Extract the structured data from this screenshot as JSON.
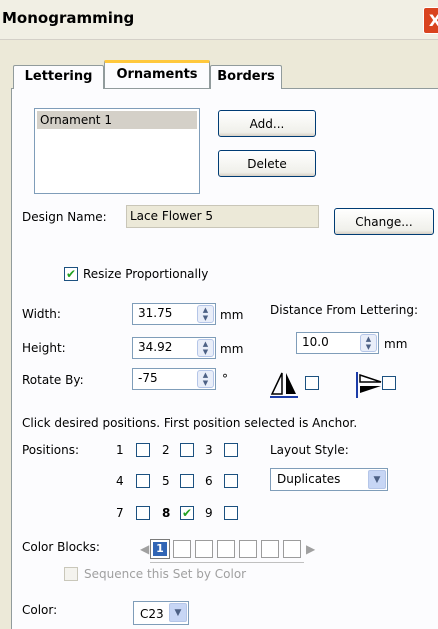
{
  "window": {
    "title": "Monogramming",
    "close_label": "X"
  },
  "tabs": [
    {
      "label": "Lettering",
      "active": false
    },
    {
      "label": "Ornaments",
      "active": true
    },
    {
      "label": "Borders",
      "active": false
    }
  ],
  "ornaments": {
    "items": [
      "Ornament 1"
    ],
    "add_label": "Add...",
    "delete_label": "Delete"
  },
  "design": {
    "label": "Design Name:",
    "value": "Lace Flower 5",
    "change_label": "Change..."
  },
  "resize": {
    "label": "Resize Proportionally",
    "checked": true
  },
  "size": {
    "width_label": "Width:",
    "width_value": "31.75",
    "height_label": "Height:",
    "height_value": "34.92",
    "rotate_label": "Rotate By:",
    "rotate_value": "-75",
    "unit": "mm",
    "degree_symbol": "°"
  },
  "distance": {
    "label": "Distance From Lettering:",
    "value": "10.0",
    "unit": "mm"
  },
  "mirror": {
    "vertical_checked": false,
    "horizontal_checked": false
  },
  "positions": {
    "instructions": "Click desired positions. First position selected is Anchor.",
    "label": "Positions:",
    "items": [
      {
        "num": "1",
        "checked": false
      },
      {
        "num": "2",
        "checked": false
      },
      {
        "num": "3",
        "checked": false
      },
      {
        "num": "4",
        "checked": false
      },
      {
        "num": "5",
        "checked": false
      },
      {
        "num": "6",
        "checked": false
      },
      {
        "num": "7",
        "checked": false
      },
      {
        "num": "8",
        "checked": true
      },
      {
        "num": "9",
        "checked": false
      }
    ]
  },
  "layout": {
    "label": "Layout Style:",
    "value": "Duplicates"
  },
  "color_blocks": {
    "label": "Color Blocks:",
    "selected": "1",
    "sequence_label": "Sequence this Set by Color"
  },
  "color": {
    "label": "Color:",
    "value": "C23"
  },
  "colors": {
    "accent_tab": "#ffc83c",
    "close_button": "#d9431f",
    "selected_block": "#3165b5",
    "check_mark": "#21a121"
  }
}
